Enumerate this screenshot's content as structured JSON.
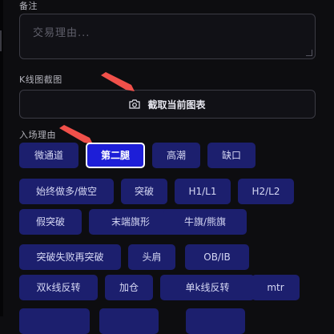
{
  "notes": {
    "label": "备注",
    "placeholder": "交易理由..."
  },
  "kline": {
    "label": "K线图截图",
    "capture_label": "截取当前图表",
    "icon": "camera-icon"
  },
  "reasons": {
    "label": "入场理由",
    "chips": [
      {
        "label": "微通道",
        "active": false
      },
      {
        "label": "第二腿",
        "active": true
      },
      {
        "label": "高潮",
        "active": false
      },
      {
        "label": "缺口",
        "active": false
      },
      {
        "label": "始终做多/做空",
        "active": false
      },
      {
        "label": "突破",
        "active": false
      },
      {
        "label": "H1/L1",
        "active": false
      },
      {
        "label": "H2/L2",
        "active": false
      },
      {
        "label": "假突破",
        "active": false
      },
      {
        "label": "末端旗形",
        "active": false
      },
      {
        "label": "牛旗/熊旗",
        "active": false
      },
      {
        "label": "突破失败再突破",
        "active": false
      },
      {
        "label": "头肩",
        "active": false
      },
      {
        "label": "OB/IB",
        "active": false
      },
      {
        "label": "双k线反转",
        "active": false
      },
      {
        "label": "加仓",
        "active": false
      },
      {
        "label": "单k线反转",
        "active": false
      },
      {
        "label": "mtr",
        "active": false
      },
      {
        "label": "",
        "active": false
      },
      {
        "label": "",
        "active": false
      },
      {
        "label": "",
        "active": false
      }
    ]
  },
  "colors": {
    "chip_bg": "#1c1f6e",
    "chip_active_bg": "#1d1ed8",
    "annotation_arrow": "#f0504a"
  }
}
